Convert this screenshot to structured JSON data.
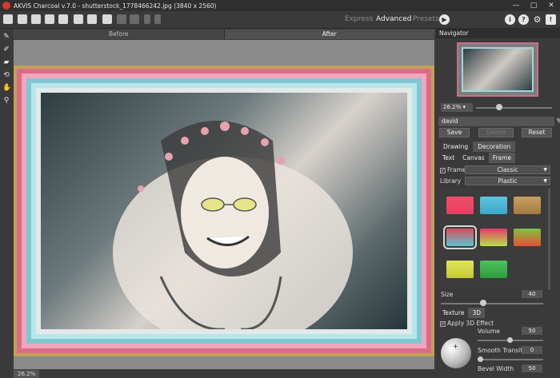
{
  "window": {
    "title": "AKVIS Charcoal v.7.0 - shutterstock_1778466242.jpg (3840 x 2560)",
    "controls": [
      "—",
      "□",
      "✕"
    ]
  },
  "toolbar": {
    "modes": [
      {
        "label": "Express",
        "active": false
      },
      {
        "label": "Advanced",
        "active": true
      },
      {
        "label": "Presets",
        "active": false
      }
    ],
    "icons": [
      "open-file-icon",
      "save-file-icon",
      "export-icon",
      "print-icon",
      "share-icon",
      "batch-icon",
      "background-icon",
      "checkbox-icon",
      "disabled-icon",
      "disabled-icon",
      "undo-icon",
      "redo-icon",
      "run-icon",
      "info-icon",
      "help-icon",
      "settings-icon",
      "notifications-icon"
    ],
    "run_glyph": "▶",
    "info_glyph": "i",
    "help_glyph": "?",
    "settings_glyph": "⚙",
    "notify_glyph": "!"
  },
  "tools": [
    {
      "name": "charcoal-tool-icon",
      "glyph": "✎"
    },
    {
      "name": "eraser-stroke-icon",
      "glyph": "✐"
    },
    {
      "name": "eraser-icon",
      "glyph": "▰"
    },
    {
      "name": "history-brush-icon",
      "glyph": "⟲"
    },
    {
      "name": "hand-icon",
      "glyph": "✋"
    },
    {
      "name": "zoom-icon",
      "glyph": "⚲"
    }
  ],
  "view_tabs": {
    "before": "Before",
    "after": "After"
  },
  "status": {
    "zoom": "26.2%"
  },
  "navigator": {
    "title": "Navigator",
    "zoom": "26.2% ▾"
  },
  "preset": {
    "name": "david",
    "heart": "♥",
    "buttons": {
      "save": "Save",
      "delete": "Delete",
      "reset": "Reset"
    }
  },
  "tabs_main": [
    {
      "label": "Drawing",
      "active": false
    },
    {
      "label": "Decoration",
      "active": true
    }
  ],
  "tabs_sub": [
    {
      "label": "Text",
      "active": false
    },
    {
      "label": "Canvas",
      "active": false
    },
    {
      "label": "Frame",
      "active": true
    }
  ],
  "frame": {
    "checkbox_label": "Frame",
    "checked": true,
    "type": "Classic",
    "library_label": "Library",
    "library": "Plastic"
  },
  "swatches": [
    {
      "colors": [
        "#f0506b",
        "#e64060"
      ],
      "selected": false
    },
    {
      "colors": [
        "#5ec4e0",
        "#3aa8c8"
      ],
      "selected": false
    },
    {
      "colors": [
        "#c9a062",
        "#a27a40"
      ],
      "selected": false
    },
    {
      "colors": [
        "#d94f5c",
        "#5ac3d1"
      ],
      "selected": true
    },
    {
      "colors": [
        "#e43a6b",
        "#b8e048"
      ],
      "selected": false
    },
    {
      "colors": [
        "#7cc43c",
        "#e8503a"
      ],
      "selected": false
    },
    {
      "colors": [
        "#e2e65a",
        "#c6c83a"
      ],
      "selected": false
    },
    {
      "colors": [
        "#4ec25a",
        "#2f9c3e"
      ],
      "selected": false
    }
  ],
  "size": {
    "label": "Size",
    "value": "40",
    "level": 0.4
  },
  "tabs_bottom": [
    {
      "label": "Texture",
      "active": false
    },
    {
      "label": "3D",
      "active": true
    }
  ],
  "effect3d": {
    "checkbox_label": "Apply 3D Effect",
    "checked": true,
    "params": [
      {
        "label": "Volume",
        "value": "50",
        "level": 0.5
      },
      {
        "label": "Smooth Transition",
        "value": "0",
        "level": 0.0
      },
      {
        "label": "Bevel Width",
        "value": "50",
        "level": 0.5
      }
    ],
    "sphere_plus": "+"
  },
  "colors": {
    "accent_pink": "#dc6c86",
    "accent_cyan": "#7fc8d2",
    "frame_gold": "#c0a158"
  }
}
